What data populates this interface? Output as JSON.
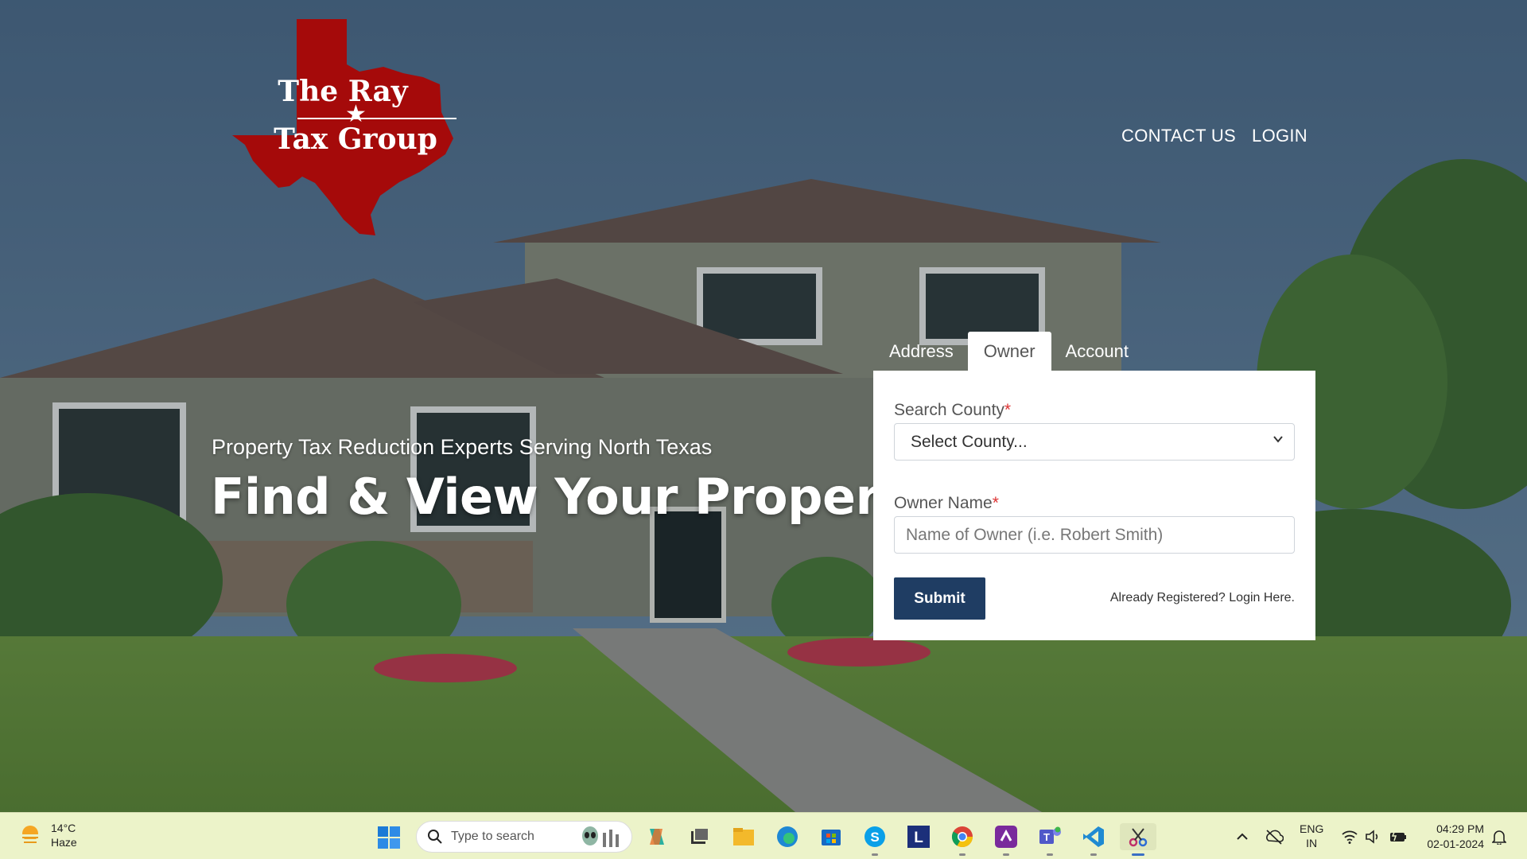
{
  "logo": {
    "line1": "The Ray",
    "line2": "Tax Group",
    "star": "★",
    "color": "#a50a0a"
  },
  "nav": {
    "contact": "CONTACT US",
    "login": "LOGIN"
  },
  "hero": {
    "tagline": "Property Tax Reduction Experts Serving North Texas",
    "headline": "Find & View Your Property"
  },
  "search": {
    "tabs": [
      "Address",
      "Owner",
      "Account"
    ],
    "active_tab": "Owner",
    "county_label": "Search County",
    "county_value": "Select County...",
    "owner_label": "Owner Name",
    "required_mark": "*",
    "owner_placeholder": "Name of Owner (i.e. Robert Smith)",
    "submit_label": "Submit",
    "login_link": "Already Registered? Login Here."
  },
  "taskbar": {
    "weather_temp": "14°C",
    "weather_desc": "Haze",
    "search_placeholder": "Type to search",
    "apps": [
      "copilot-icon",
      "task-view-icon",
      "file-explorer-icon",
      "edge-icon",
      "store-icon",
      "skype-icon",
      "l-app-icon",
      "chrome-icon",
      "clipchamp-icon",
      "teams-icon",
      "vscode-icon",
      "snipping-tool-icon"
    ],
    "lang_line1": "ENG",
    "lang_line2": "IN",
    "time": "04:29 PM",
    "date": "02-01-2024"
  }
}
